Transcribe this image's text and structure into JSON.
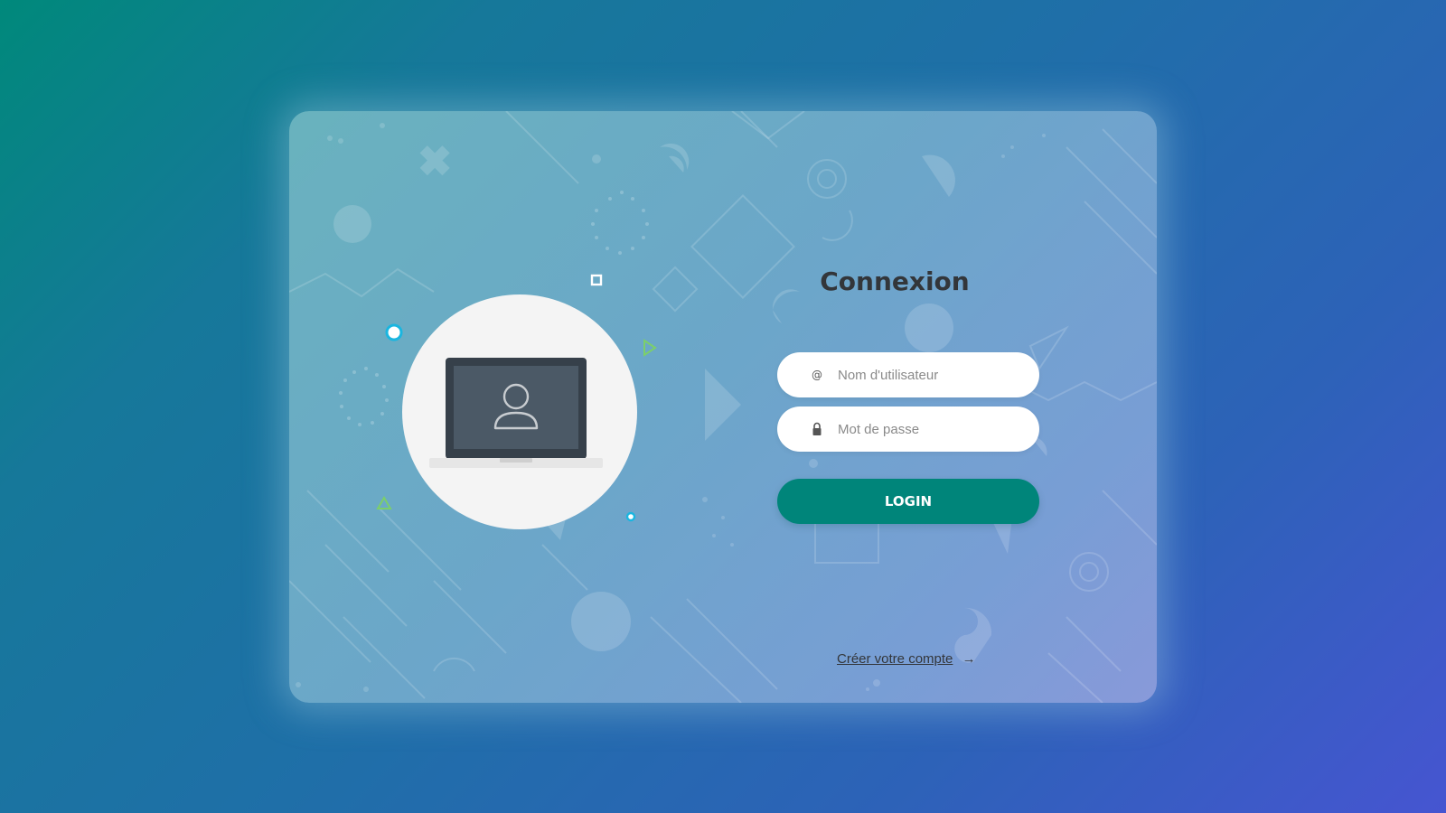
{
  "login_form": {
    "title": "Connexion",
    "username": {
      "placeholder": "Nom d'utilisateur",
      "icon": "at-icon",
      "icon_glyph": "@"
    },
    "password": {
      "placeholder": "Mot de passe",
      "icon": "lock-icon"
    },
    "submit_label": "LOGIN",
    "create_account": {
      "label": "Créer votre compte",
      "icon": "arrow-right-icon",
      "arrow_glyph": "→"
    }
  },
  "illustration": {
    "icon": "laptop-user-icon"
  },
  "colors": {
    "primary": "#00857a",
    "title_text": "#33363a",
    "input_background": "#ffffff",
    "accent_cyan": "#1ab6e0",
    "accent_green": "#7ccf6a"
  }
}
